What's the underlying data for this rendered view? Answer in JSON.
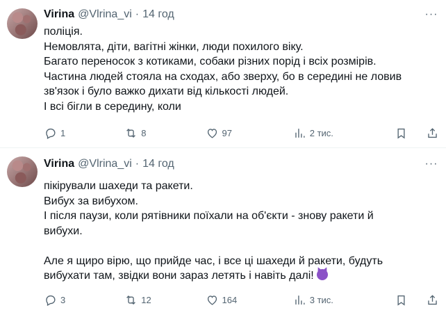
{
  "tweets": [
    {
      "author_name": "Virina",
      "author_handle": "@Vlrina_vi",
      "separator": "·",
      "time": "14 год",
      "more": "···",
      "lines": [
        "поліція.",
        "Немовлята, діти, вагітні жінки, люди похилого віку.",
        "Багато переносок з котиками, собаки різних порід і всіх розмірів.",
        "Частина людей стояла на сходах, або зверху, бо в середині не ловив",
        "зв'язок і було важко дихати від кількості людей.",
        "І всі бігли в середину, коли"
      ],
      "replies": "1",
      "retweets": "8",
      "likes": "97",
      "views": "2 тис."
    },
    {
      "author_name": "Virina",
      "author_handle": "@Vlrina_vi",
      "separator": "·",
      "time": "14 год",
      "more": "···",
      "lines": [
        "пікірували шахеди та ракети.",
        "Вибух за вибухом.",
        "І після паузи, коли рятівники поїхали на об'єкти - знову ракети й",
        "вибухи.",
        "",
        "Але я щиро вірю, що прийде час, і все ці шахеди й ракети, будуть",
        "вибухати там, звідки вони зараз летять і навіть далі!"
      ],
      "replies": "3",
      "retweets": "12",
      "likes": "164",
      "views": "3 тис."
    }
  ],
  "icons": {
    "reply": "reply-icon",
    "retweet": "retweet-icon",
    "like": "heart-icon",
    "views": "views-icon",
    "bookmark": "bookmark-icon",
    "share": "share-icon",
    "emoji": "smiling-devil-emoji"
  },
  "colors": {
    "text": "#0f1419",
    "muted": "#536471",
    "divider": "#eff3f4",
    "emoji": "#8b52c7"
  }
}
